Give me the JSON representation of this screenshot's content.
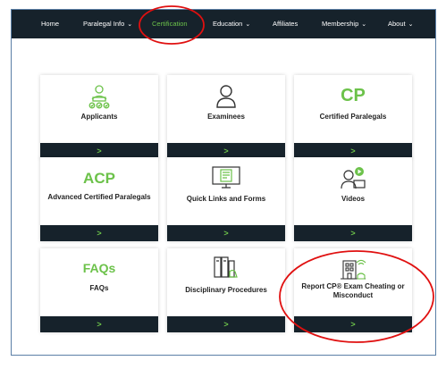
{
  "nav": {
    "home": "Home",
    "paralegal_info": "Paralegal Info",
    "certification": "Certification",
    "education": "Education",
    "affiliates": "Affiliates",
    "membership": "Membership",
    "about": "About",
    "chevron": "❯"
  },
  "cards": {
    "applicants": {
      "label": "Applicants",
      "icon": "applicants-icon",
      "arrow": ">"
    },
    "examinees": {
      "label": "Examinees",
      "icon": "person-icon",
      "arrow": ">"
    },
    "certified": {
      "label": "Certified Paralegals",
      "logo": "CP",
      "arrow": ">"
    },
    "acp": {
      "label": "Advanced Certified Paralegals",
      "logo": "ACP",
      "arrow": ">"
    },
    "quick_links": {
      "label": "Quick Links and Forms",
      "icon": "monitor-form-icon",
      "arrow": ">"
    },
    "videos": {
      "label": "Videos",
      "icon": "video-person-icon",
      "arrow": ">"
    },
    "faqs": {
      "label": "FAQs",
      "logo": "FAQs",
      "arrow": ">"
    },
    "disciplinary": {
      "label": "Disciplinary Procedures",
      "icon": "binders-hand-icon",
      "arrow": ">"
    },
    "report": {
      "label": "Report CP® Exam Cheating or Misconduct",
      "icon": "building-wifi-icon",
      "arrow": ">"
    }
  },
  "colors": {
    "accent": "#6cc24a",
    "dark": "#16222b",
    "annotation": "#e01010"
  }
}
